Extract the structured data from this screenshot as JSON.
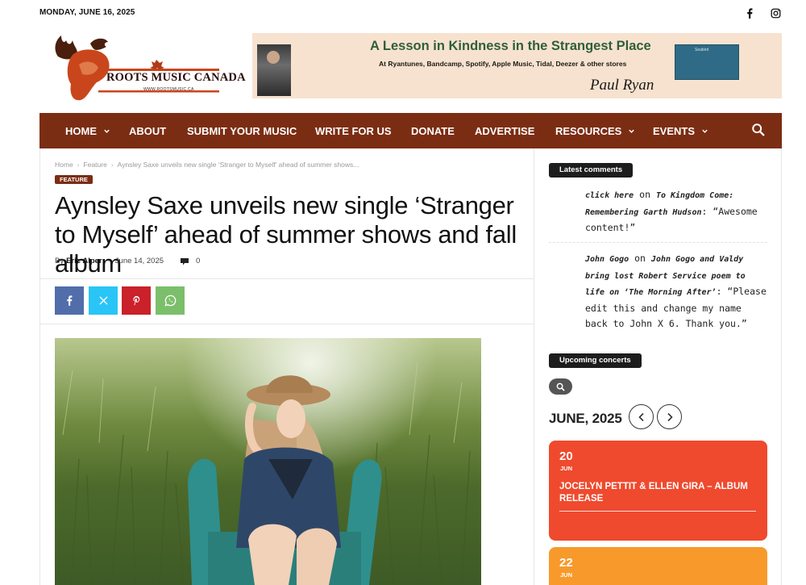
{
  "topbar": {
    "date": "MONDAY, JUNE 16, 2025",
    "icons": [
      "facebook-icon",
      "instagram-icon"
    ]
  },
  "logo": {
    "text": "ROOTS MUSIC CANADA",
    "url_text": "WWW.ROOTSMUSIC.CA"
  },
  "banner": {
    "title": "A Lesson in Kindness in the Strangest Place",
    "subtitle": "At Ryantunes, Bandcamp, Spotify, Apple Music, Tidal, Deezer & other stores",
    "signature": "Paul Ryan",
    "album_label": "Seabird"
  },
  "nav": {
    "items": [
      {
        "label": "HOME",
        "has_caret": true
      },
      {
        "label": "ABOUT",
        "has_caret": false
      },
      {
        "label": "SUBMIT YOUR MUSIC",
        "has_caret": false
      },
      {
        "label": "WRITE FOR US",
        "has_caret": false
      },
      {
        "label": "DONATE",
        "has_caret": false
      },
      {
        "label": "ADVERTISE",
        "has_caret": false
      },
      {
        "label": "RESOURCES",
        "has_caret": true
      },
      {
        "label": "EVENTS",
        "has_caret": true
      }
    ],
    "caret": "⌄",
    "color": "#7b2d13"
  },
  "article": {
    "breadcrumb": [
      "Home",
      "Feature",
      "Aynsley Saxe unveils new single ‘Stranger to Myself’ ahead of summer shows..."
    ],
    "breadcrumb_sep": "›",
    "tag": "FEATURE",
    "title": "Aynsley Saxe unveils new single ‘Stranger to Myself’ ahead of summer shows and fall album",
    "by": "By",
    "author": "Eric Alper",
    "dash": "-",
    "date": "June 14, 2025",
    "comment_count": "0",
    "share": [
      {
        "name": "facebook",
        "color": "#516eab",
        "icon": "facebook-icon"
      },
      {
        "name": "x",
        "color": "#29c5f6",
        "icon": "x-icon"
      },
      {
        "name": "pinterest",
        "color": "#ca212a",
        "icon": "pinterest-icon"
      },
      {
        "name": "whatsapp",
        "color": "#7bbf6a",
        "icon": "whatsapp-icon"
      }
    ]
  },
  "sidebar": {
    "latest_comments_label": "Latest comments",
    "comments": [
      {
        "author": "click here",
        "on": "on",
        "post": "To Kingdom Come: Remembering Garth Hudson",
        "text": ": “Awesome content!”"
      },
      {
        "author": "John Gogo",
        "on": "on",
        "post": "John Gogo and Valdy bring lost Robert Service poem to life on ‘The Morning After’",
        "text": ": “Please edit this and change my name back to John X 6. Thank you.”"
      }
    ],
    "concerts_label": "Upcoming concerts",
    "month": "JUNE, 2025",
    "events": [
      {
        "day": "20",
        "month": "JUN",
        "title": "JOCELYN PETTIT & ELLEN GIRA – ALBUM RELEASE",
        "color": "#ef4a2e"
      },
      {
        "day": "22",
        "month": "JUN",
        "title": "",
        "color": "#f79a2b"
      }
    ]
  }
}
